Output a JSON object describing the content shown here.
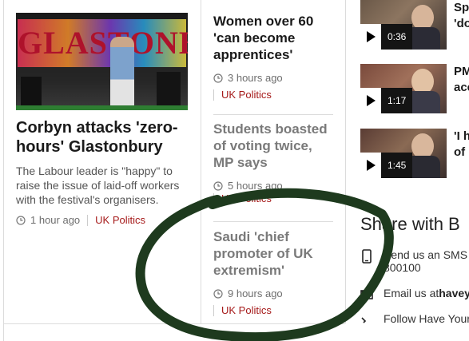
{
  "lead_story": {
    "title": "Corbyn attacks 'zero-hours' Glastonbury",
    "summary": "The Labour leader is \"happy\" to raise the issue of laid-off workers with the festival's organisers.",
    "time": "1 hour ago",
    "tag": "UK Politics"
  },
  "middle_stories": [
    {
      "title": "Women over 60 'can become apprentices'",
      "time": "3 hours ago",
      "tag": "UK Politics"
    },
    {
      "title": "Students boasted of voting twice, MP says",
      "time": "5 hours ago",
      "tag": "UK Politics"
    },
    {
      "title": "Saudi 'chief promoter of UK extremism'",
      "time": "9 hours ago",
      "tag": "UK Politics"
    }
  ],
  "videos": [
    {
      "title_line1": "Sp",
      "title_line2": "'do",
      "duration": "0:36"
    },
    {
      "title_line1": "PM",
      "title_line2": "acc",
      "duration": "1:17"
    },
    {
      "title_line1": "'I h",
      "title_line2": "of I",
      "duration": "1:45"
    }
  ],
  "share": {
    "heading": "Share with B",
    "sms_line1": "Send us an SMS",
    "sms_line2": "800100",
    "email_prefix": "Email us at ",
    "email_address": "havey",
    "follow": "Follow Have Your"
  },
  "colors": {
    "tag": "#a61b1b",
    "circle": "#1e3a1e"
  },
  "icons": {
    "clock": "clock-icon",
    "play": "play-icon",
    "phone": "phone-icon",
    "email": "envelope-icon"
  }
}
